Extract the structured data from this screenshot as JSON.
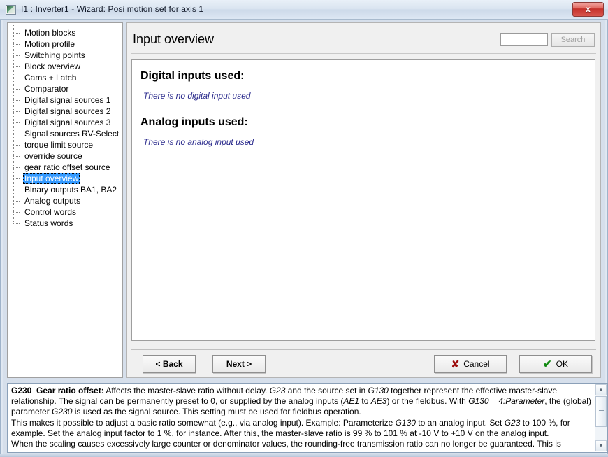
{
  "window": {
    "title": "I1 : Inverter1 - Wizard: Posi motion set for axis 1",
    "close_label": "x",
    "icon": "window-icon"
  },
  "sidebar": {
    "items": [
      {
        "label": "Motion blocks",
        "selected": false
      },
      {
        "label": "Motion profile",
        "selected": false
      },
      {
        "label": "Switching points",
        "selected": false
      },
      {
        "label": "Block overview",
        "selected": false
      },
      {
        "label": "Cams + Latch",
        "selected": false
      },
      {
        "label": "Comparator",
        "selected": false
      },
      {
        "label": "Digital signal sources 1",
        "selected": false
      },
      {
        "label": "Digital signal sources 2",
        "selected": false
      },
      {
        "label": "Digital signal sources 3",
        "selected": false
      },
      {
        "label": "Signal sources RV-Select",
        "selected": false
      },
      {
        "label": "torque limit source",
        "selected": false
      },
      {
        "label": "override source",
        "selected": false
      },
      {
        "label": "gear ratio offset source",
        "selected": false
      },
      {
        "label": "Input overview",
        "selected": true
      },
      {
        "label": "Binary outputs BA1, BA2",
        "selected": false
      },
      {
        "label": "Analog outputs",
        "selected": false
      },
      {
        "label": "Control words",
        "selected": false
      },
      {
        "label": "Status words",
        "selected": false
      }
    ],
    "selection_color": "#3399ff"
  },
  "main": {
    "page_title": "Input overview",
    "search": {
      "value": "",
      "placeholder": "",
      "button_label": "Search",
      "button_enabled": false
    },
    "document": {
      "digital_heading": "Digital inputs used:",
      "digital_body": "There is no digital input used",
      "analog_heading": "Analog inputs used:",
      "analog_body": "There is no analog input used",
      "body_color": "#2a2a8c"
    }
  },
  "buttons": {
    "back": "< Back",
    "next": "Next >",
    "cancel": "Cancel",
    "cancel_glyph": "✘",
    "ok": "OK",
    "ok_glyph": "✔"
  },
  "help": {
    "param_id": "G230",
    "param_name": "Gear ratio offset:",
    "paragraph1_a": " Affects the master-slave ratio without delay. ",
    "paragraph1_i1": "G23",
    "paragraph1_b": " and the source set in ",
    "paragraph1_i2": "G130",
    "paragraph1_c": " together represent the effective master-slave relationship. The signal can be permanently preset to 0, or supplied by the analog inputs (",
    "paragraph1_i3": "AE1",
    "paragraph1_d": " to ",
    "paragraph1_i4": "AE3",
    "paragraph1_e": ") or the fieldbus. With ",
    "paragraph1_i5": "G130 = 4:Parameter",
    "paragraph1_f": ", the (global) parameter ",
    "paragraph1_i6": "G230",
    "paragraph1_g": " is used as the signal source. This setting must be used for fieldbus operation.",
    "paragraph2_a": "This makes it possible to adjust a basic ratio somewhat (e.g., via analog input). Example: Parameterize ",
    "paragraph2_i1": "G130",
    "paragraph2_b": " to an analog input. Set ",
    "paragraph2_i2": "G23",
    "paragraph2_c": " to 100 %, for example. Set the analog input factor to 1 %, for instance. After this, the master-slave ratio is 99 % to 101 % at -10 V to +10 V on the analog input.",
    "paragraph3": "When the scaling causes excessively large counter or denominator values, the rounding-free transmission ratio can no longer be guaranteed. This is",
    "scroll_up": "▲",
    "scroll_down": "▼"
  }
}
